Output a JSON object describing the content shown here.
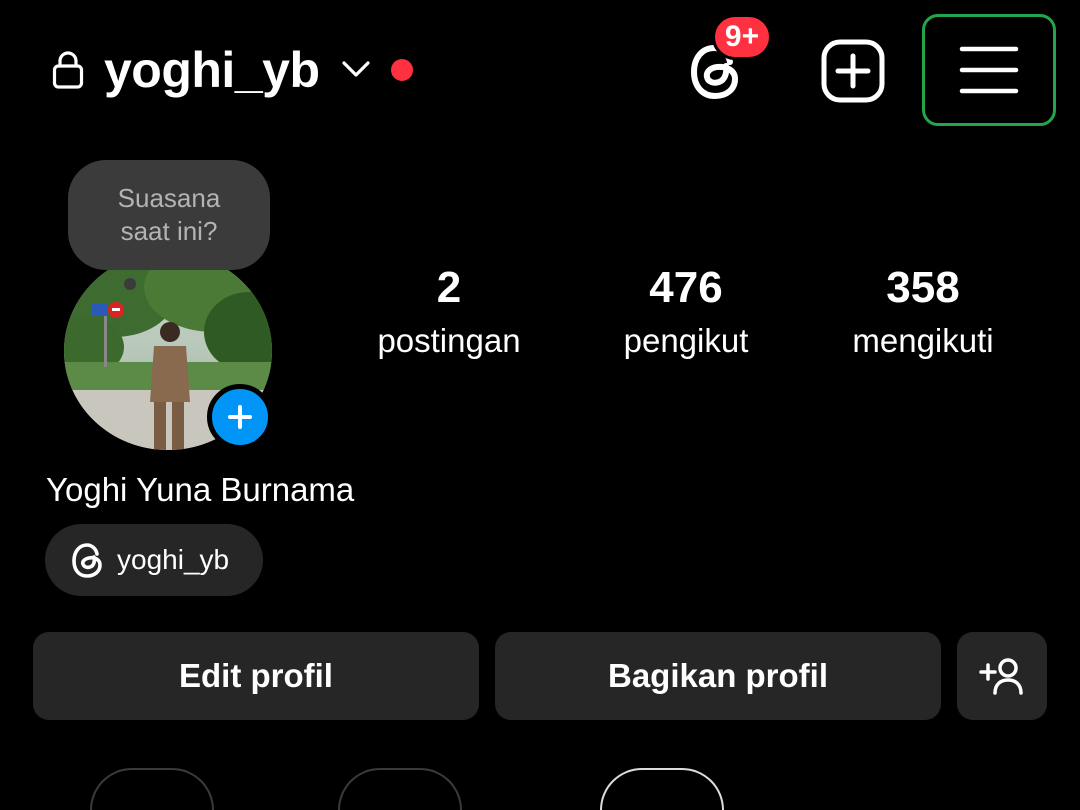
{
  "header": {
    "username": "yoghi_yb",
    "notification_badge": "9+",
    "icons": {
      "lock": "lock-icon",
      "chevron": "chevron-down-icon",
      "threads": "threads-icon",
      "create": "plus-square-icon",
      "menu": "hamburger-menu-icon"
    }
  },
  "note": {
    "text_line1": "Suasana",
    "text_line2": "saat ini?"
  },
  "stats": [
    {
      "value": "2",
      "label": "postingan"
    },
    {
      "value": "476",
      "label": "pengikut"
    },
    {
      "value": "358",
      "label": "mengikuti"
    }
  ],
  "profile": {
    "full_name": "Yoghi Yuna Burnama",
    "threads_handle": "yoghi_yb"
  },
  "actions": {
    "edit": "Edit profil",
    "share": "Bagikan profil"
  },
  "colors": {
    "background": "#000000",
    "badge": "#ff3040",
    "accent_blue": "#0095f6",
    "button_bg": "#262626",
    "highlight_border": "#23a64a"
  }
}
